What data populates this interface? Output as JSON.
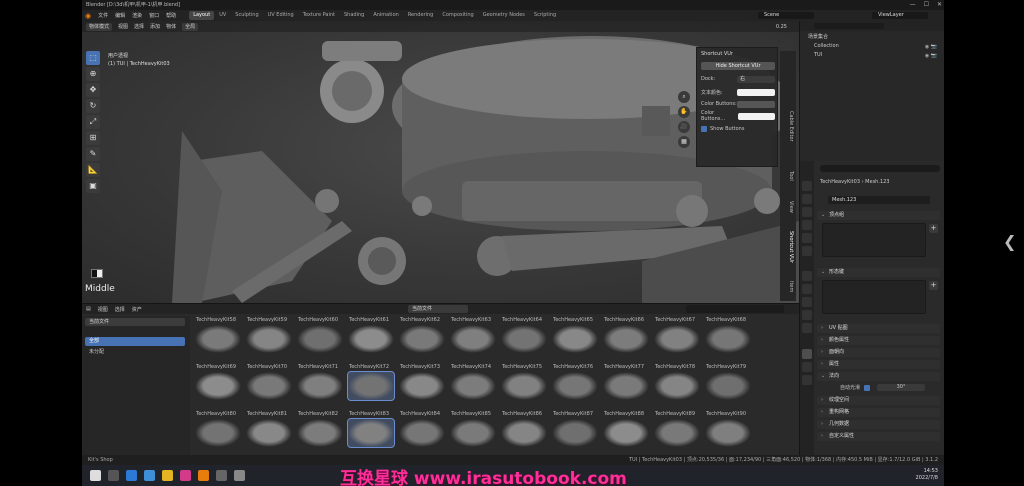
{
  "titlebar": {
    "text": "Blender [D:\\3d\\机甲\\机甲-1\\机甲.blend]"
  },
  "menu": [
    "文件",
    "编辑",
    "渲染",
    "窗口",
    "帮助"
  ],
  "workspaces": [
    "Layout",
    "UV",
    "Sculpting",
    "UV Editing",
    "Texture Paint",
    "Shading",
    "Animation",
    "Rendering",
    "Compositing",
    "Geometry Nodes",
    "Scripting"
  ],
  "active_workspace": "Layout",
  "scene": "Scene",
  "view_layer": "ViewLayer",
  "viewport": {
    "mode": "物体模式",
    "menus": [
      "视图",
      "选择",
      "添加",
      "物体"
    ],
    "transform": "全局",
    "info_line1": "用户透视",
    "info_line2": "(1) TUI | TechHeavyKit03",
    "zoom": "0.25",
    "brush_label": "Middle"
  },
  "shortcut_panel": {
    "title": "Shortcut VUr",
    "button": "Hide Shortcut VUr",
    "dock_label": "Dock:",
    "dock_value": "右",
    "text_label": "文本颜色:",
    "color_buttons_label": "Color Buttons:",
    "color_buttons2_label": "Color Buttons...",
    "show_buttons": "Show Buttons"
  },
  "side_tabs": [
    "Cable Editor",
    "Tool",
    "View",
    "Shortcut VUr",
    "Item"
  ],
  "asset_browser": {
    "menus": [
      "视图",
      "选择",
      "资产"
    ],
    "library": "当前文件",
    "library_drop": "当前文件",
    "cat_all": "全部",
    "cat_unassigned": "未分配",
    "rows": [
      [
        "TechHeavyKit58",
        "TechHeavyKit59",
        "TechHeavyKit60",
        "TechHeavyKit61",
        "TechHeavyKit62",
        "TechHeavyKit63",
        "TechHeavyKit64",
        "TechHeavyKit65",
        "TechHeavyKit66",
        "TechHeavyKit67",
        "TechHeavyKit68"
      ],
      [
        "TechHeavyKit69",
        "TechHeavyKit70",
        "TechHeavyKit71",
        "TechHeavyKit72",
        "TechHeavyKit73",
        "TechHeavyKit74",
        "TechHeavyKit75",
        "TechHeavyKit76",
        "TechHeavyKit77",
        "TechHeavyKit78",
        "TechHeavyKit79"
      ],
      [
        "TechHeavyKit80",
        "TechHeavyKit81",
        "TechHeavyKit82",
        "TechHeavyKit83",
        "TechHeavyKit84",
        "TechHeavyKit85",
        "TechHeavyKit86",
        "TechHeavyKit87",
        "TechHeavyKit88",
        "TechHeavyKit89",
        "TechHeavyKit90"
      ]
    ]
  },
  "outliner": {
    "rows": [
      "场景集合",
      "Collection",
      "TUI"
    ]
  },
  "properties": {
    "crumb": "TechHeavyKit03  ›  Mesh.123",
    "mesh_name": "Mesh.123",
    "sections": [
      "顶点组",
      "形态键",
      "UV 贴图",
      "颜色属性",
      "面朝向",
      "属性",
      "法向",
      "纹理空间",
      "重构网格",
      "几何数据",
      "自定义属性"
    ],
    "autosmooth_label": "自动光滑",
    "autosmooth_value": "30°"
  },
  "statusbar": {
    "left": "Kit's Shop",
    "right": "TUI | TechHeavyKit03 | 顶点:20,535/36 | 面:17,234/90 | 三角面:46,520 | 物体:1/368 | 内存:450.5 MiB | 显存:1.7/12.0 GiB | 3.1.2"
  },
  "taskbar": {
    "time": "14:53",
    "date": "2022/7/8"
  },
  "watermark": "互换星球 www.irasutobook.com",
  "colors": {
    "accent": "#4772b3",
    "watermark": "#ff2e98"
  }
}
